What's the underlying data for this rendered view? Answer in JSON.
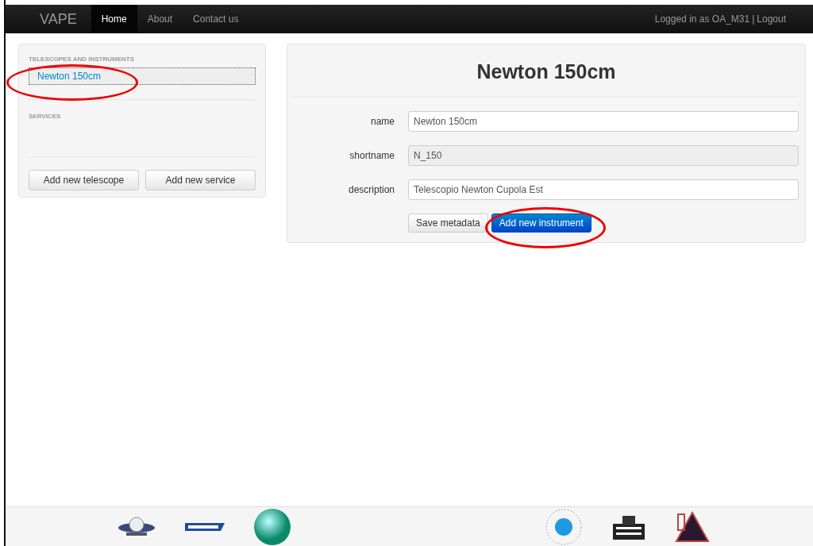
{
  "navbar": {
    "brand": "VAPE",
    "items": [
      {
        "label": "Home",
        "selected": true
      },
      {
        "label": "About",
        "selected": false
      },
      {
        "label": "Contact us",
        "selected": false
      }
    ],
    "user_text": "Logged in as OA_M31",
    "separator": "|",
    "logout": "Logout"
  },
  "sidebar": {
    "sections": [
      {
        "heading": "TELESCOPES AND INSTRUMENTS",
        "items": [
          {
            "label": "Newton 150cm",
            "selected": true
          }
        ]
      },
      {
        "heading": "SERVICES"
      }
    ],
    "buttons": [
      "Add new telescope",
      "Add new service"
    ]
  },
  "main": {
    "title": "Newton 150cm",
    "fields": [
      {
        "label": "name",
        "value": "Newton 150cm",
        "disabled": false
      },
      {
        "label": "shortname",
        "value": "N_150",
        "disabled": true
      },
      {
        "label": "description",
        "value": "Telescopio Newton Cupola Est",
        "disabled": false
      }
    ],
    "buttons": [
      {
        "label": "Save metadata",
        "kind": "default"
      },
      {
        "label": "Add new instrument",
        "kind": "primary"
      }
    ]
  }
}
